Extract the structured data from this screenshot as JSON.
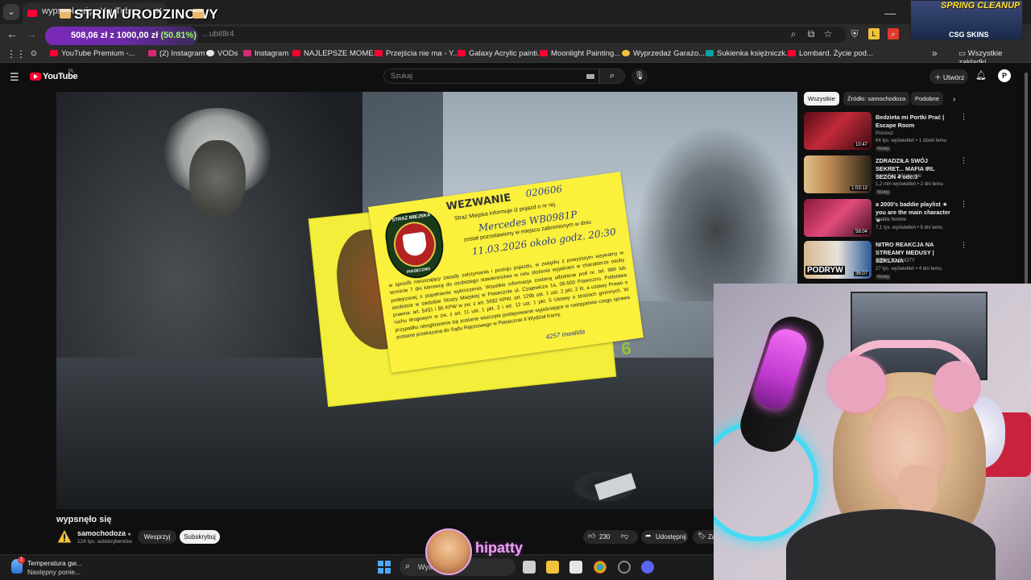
{
  "browser": {
    "tab_title": "wypsnęło się - YouTube",
    "overlay_title": "STRIM URODZINOWY",
    "url_fragment": "…ubit8r4",
    "donation": {
      "amount": "508,06 zł",
      "connector": "z",
      "goal": "1000,00 zł",
      "percent": "(50.81%)"
    },
    "promo_title": "SPRING CLEANUP",
    "promo_brand": "CSG SKINS"
  },
  "bookmarks": {
    "items": [
      {
        "label": "YouTube Premium -...",
        "color": "#ff0033"
      },
      {
        "label": "(2) Instagram",
        "color": "#d62976"
      },
      {
        "label": "VODs",
        "color": "#e6e6e6"
      },
      {
        "label": "Instagram",
        "color": "#d62976"
      },
      {
        "label": "NAJLEPSZE MOME...",
        "color": "#ff0033"
      },
      {
        "label": "Przejścia nie ma - Y...",
        "color": "#ff0033"
      },
      {
        "label": "Galaxy Acrylic painti...",
        "color": "#ff0033"
      },
      {
        "label": "Moonlight Painting...",
        "color": "#ff0033"
      },
      {
        "label": "Wyprzedaż Garażo...",
        "color": "#f2c23a"
      },
      {
        "label": "Sukienka księżniczk...",
        "color": "#0fa2a2"
      },
      {
        "label": "Lombard. Życie pod...",
        "color": "#ff0033"
      }
    ],
    "all_label": "Wszystkie zakładki"
  },
  "youtube": {
    "logo": "YouTube",
    "region": "PL",
    "search_placeholder": "Szukaj",
    "create_label": "Utwórz",
    "avatar_letter": "P"
  },
  "ticket": {
    "title": "WEZWANIE",
    "number": "020606",
    "badge_top": "STRAŻ MIEJSKA",
    "badge_bottom": "PIASECZNO",
    "line1": "Straż Miejska informuje iż pojazd o nr rej.",
    "car": "Mercedes WB0981P",
    "line2": "został pozostawiony w miejscu zabronionym w dniu",
    "date": "11.03.2026  około godz. 20:30",
    "body": "w sposób naruszający zasady zatrzymania i postoju pojazdu, w związku z powyższym wzywamy w terminie 7 dni kierowcę do osobistego stawiennictwa w celu złożenia wyjaśnień w charakterze osoby podejrzanej o popełnienie wykroczenia. Wszelkie informacje zostaną udzielone pod nr. tel. 986 lub osobiście w siedzibie Straży Miejskiej w Piasecznie ul. Czajewicza 1a, 05-500 Piaseczno. Podstawa prawna: art. 54§1 i §6 KPW w zw. z art. 56§2 KPW, art. 129b ust. 1 ust. 2 pkt. 2 lit. a ustawy Prawo o ruchu drogowym w zw. z art. 11 ust. 1 pkt. 2 i art. 12 ust. 1 pkt. 5 Ustawy o strażach gminnych. W przypadku niezgłoszenia się zostanie wszczęte postępowanie wyjaśniające w następstwie czego sprawa zostanie przekazana do Sądu Rejonowego w Piasecznie II Wydział Karny.",
    "signature": "4257 inwalida",
    "back_number": "E\nD\n0\n6"
  },
  "video": {
    "title": "wypsnęło się",
    "channel": "samochodoza",
    "subscribers": "124 tys. subskrybentów",
    "support_label": "Wesprzyj",
    "subscribe_label": "Subskrybuj",
    "likes": "230",
    "share_label": "Udostępnij",
    "save_label": "Zap"
  },
  "chips": [
    "Wszystkie",
    "Źródło: samochodoza",
    "Podobne"
  ],
  "recommendations": [
    {
      "title": "Bedzieta mi Portki Prać | Escape Room",
      "channel": "Pronosz",
      "meta": "64 tys. wyświetleń • 1 dzień temu",
      "badge": "Nowy",
      "duration": "10:47",
      "thumb": "#7a1420"
    },
    {
      "title": "ZDRADZIŁA SWÓJ SEKRET... MAFIA IRL SEZON 4 odc.3",
      "channel": "Karol Friz Wiśniewski",
      "meta": "1,2 mln wyświetleń • 2 dni temu",
      "badge": "Nowy",
      "duration": "1:03:13",
      "thumb": "#c9a24a"
    },
    {
      "title": "a 2000's baddie playlist ★ you are the main character ★",
      "channel": "baddie femme",
      "meta": "7,1 tys. wyświetleń • 9 dni temu",
      "badge": "",
      "duration": "58:04",
      "thumb": "#b5245a"
    },
    {
      "title": "NITRO REAKCJA NA STREAMY MEDUSY | SZKLANA",
      "channel": "SERHITO SHOTY",
      "meta": "27 tys. wyświetleń • 4 dni temu",
      "badge": "Nowy",
      "duration": "36:07",
      "thumb": "#2a6aa8"
    }
  ],
  "rec_thumb_text": "PODRYW",
  "taskbar": {
    "weather_title": "Temperatura gw...",
    "weather_sub": "Następny ponie...",
    "weather_badge": "1",
    "search_placeholder": "Wysz"
  },
  "streamer": {
    "name": "hipatty"
  },
  "colors": {
    "youtube_red": "#ff0033",
    "ticket_yellow": "#fbf03b",
    "streamer_pink": "#e8a4f0"
  }
}
